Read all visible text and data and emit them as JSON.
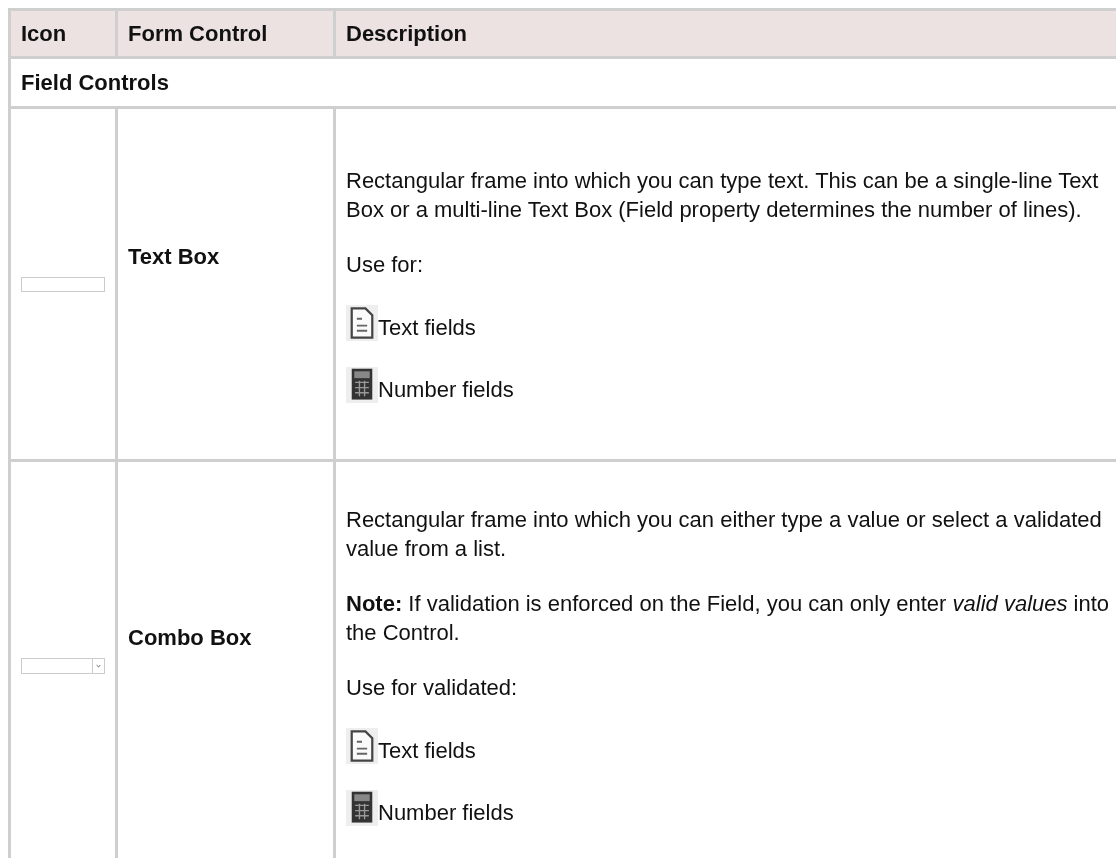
{
  "table": {
    "columns": [
      "Icon",
      "Form Control",
      "Description"
    ],
    "section": "Field Controls",
    "rows": [
      {
        "kind": "textbox",
        "name": "Text Box",
        "description": [
          {
            "kind": "paragraph",
            "text": "Rectangular frame into which you can type text. This can be a single-line Text Box or a multi-line Text Box (Field property determines the number of lines)."
          },
          {
            "kind": "paragraph",
            "text": "Use for:"
          },
          {
            "kind": "textfield",
            "text": "Text fields"
          },
          {
            "kind": "numberfield",
            "text": "Number fields"
          }
        ]
      },
      {
        "kind": "combobox",
        "name": "Combo Box",
        "description": [
          {
            "kind": "paragraph",
            "text": "Rectangular frame into which you can either type a value or select a validated value from a list."
          },
          {
            "kind": "paragraph",
            "text": "**Note:** If validation is enforced on the Field, you can only enter *valid values* into the Control."
          },
          {
            "kind": "paragraph",
            "text": "Use for validated:"
          },
          {
            "kind": "textfield",
            "text": "Text fields"
          },
          {
            "kind": "numberfield",
            "text": "Number fields"
          }
        ]
      }
    ]
  }
}
